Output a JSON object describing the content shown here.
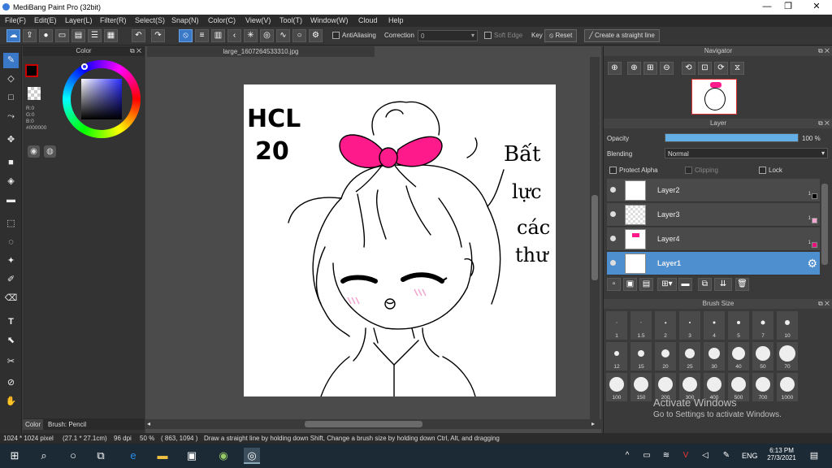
{
  "window": {
    "title": "MediBang Paint Pro (32bit)",
    "controls": [
      "—",
      "❐",
      "✕"
    ]
  },
  "menu": [
    "File(F)",
    "Edit(E)",
    "Layer(L)",
    "Filter(R)",
    "Select(S)",
    "Snap(N)",
    "Color(C)",
    "View(V)",
    "Tool(T)",
    "Window(W)",
    "Cloud",
    "Help"
  ],
  "toolbar": {
    "antialiasing_label": "AntiAliasing",
    "correction_label": "Correction",
    "correction_value": "0",
    "soft_edge_label": "Soft Edge",
    "key_label": "Key",
    "reset_label": "Reset",
    "straight_line_label": "Create a straight line"
  },
  "color_panel": {
    "title": "Color",
    "rgb": [
      "R:0",
      "G:0",
      "B:0"
    ],
    "hex": "#000000",
    "tabs": [
      "Color",
      "Brush: Pencil"
    ]
  },
  "document": {
    "tab": "large_1607264533310.jpg"
  },
  "canvas_text": {
    "top_left": [
      "HCL",
      "20"
    ],
    "right": [
      "Bất",
      "lực",
      "các",
      "thư"
    ]
  },
  "navigator": {
    "title": "Navigator"
  },
  "layer_panel": {
    "title": "Layer",
    "opacity_label": "Opacity",
    "opacity_value": "100 %",
    "opacity_fraction": 1.0,
    "blending_label": "Blending",
    "blending_value": "Normal",
    "protect_alpha": "Protect Alpha",
    "clipping": "Clipping",
    "lock": "Lock",
    "layers": [
      {
        "name": "Layer2",
        "swatch": "#000000",
        "num": "1"
      },
      {
        "name": "Layer3",
        "swatch": "#f4a6d0",
        "num": "1"
      },
      {
        "name": "Layer4",
        "swatch": "#e8107a",
        "num": "1"
      },
      {
        "name": "Layer1",
        "swatch": "",
        "num": ""
      }
    ]
  },
  "brush_size": {
    "title": "Brush Size",
    "sizes": [
      "1",
      "1.5",
      "2",
      "3",
      "4",
      "5",
      "7",
      "10",
      "12",
      "15",
      "20",
      "25",
      "30",
      "40",
      "50",
      "70",
      "100",
      "150",
      "200",
      "300",
      "400",
      "500",
      "700",
      "1000"
    ]
  },
  "status": {
    "size": "1024 * 1024 pixel",
    "cm": "(27.1 * 27.1cm)",
    "dpi": "96 dpi",
    "zoom": "50 %",
    "coords": "( 863, 1094 )",
    "hint": "Draw a straight line by holding down Shift, Change a brush size by holding down Ctrl, Alt, and dragging"
  },
  "watermark": {
    "line1": "Activate Windows",
    "line2": "Go to Settings to activate Windows."
  },
  "taskbar": {
    "lang": "ENG",
    "time": "6:13 PM",
    "date": "27/3/2021"
  },
  "colors": {
    "accent": "#3a78c8",
    "bow": "#ff1a8c"
  }
}
